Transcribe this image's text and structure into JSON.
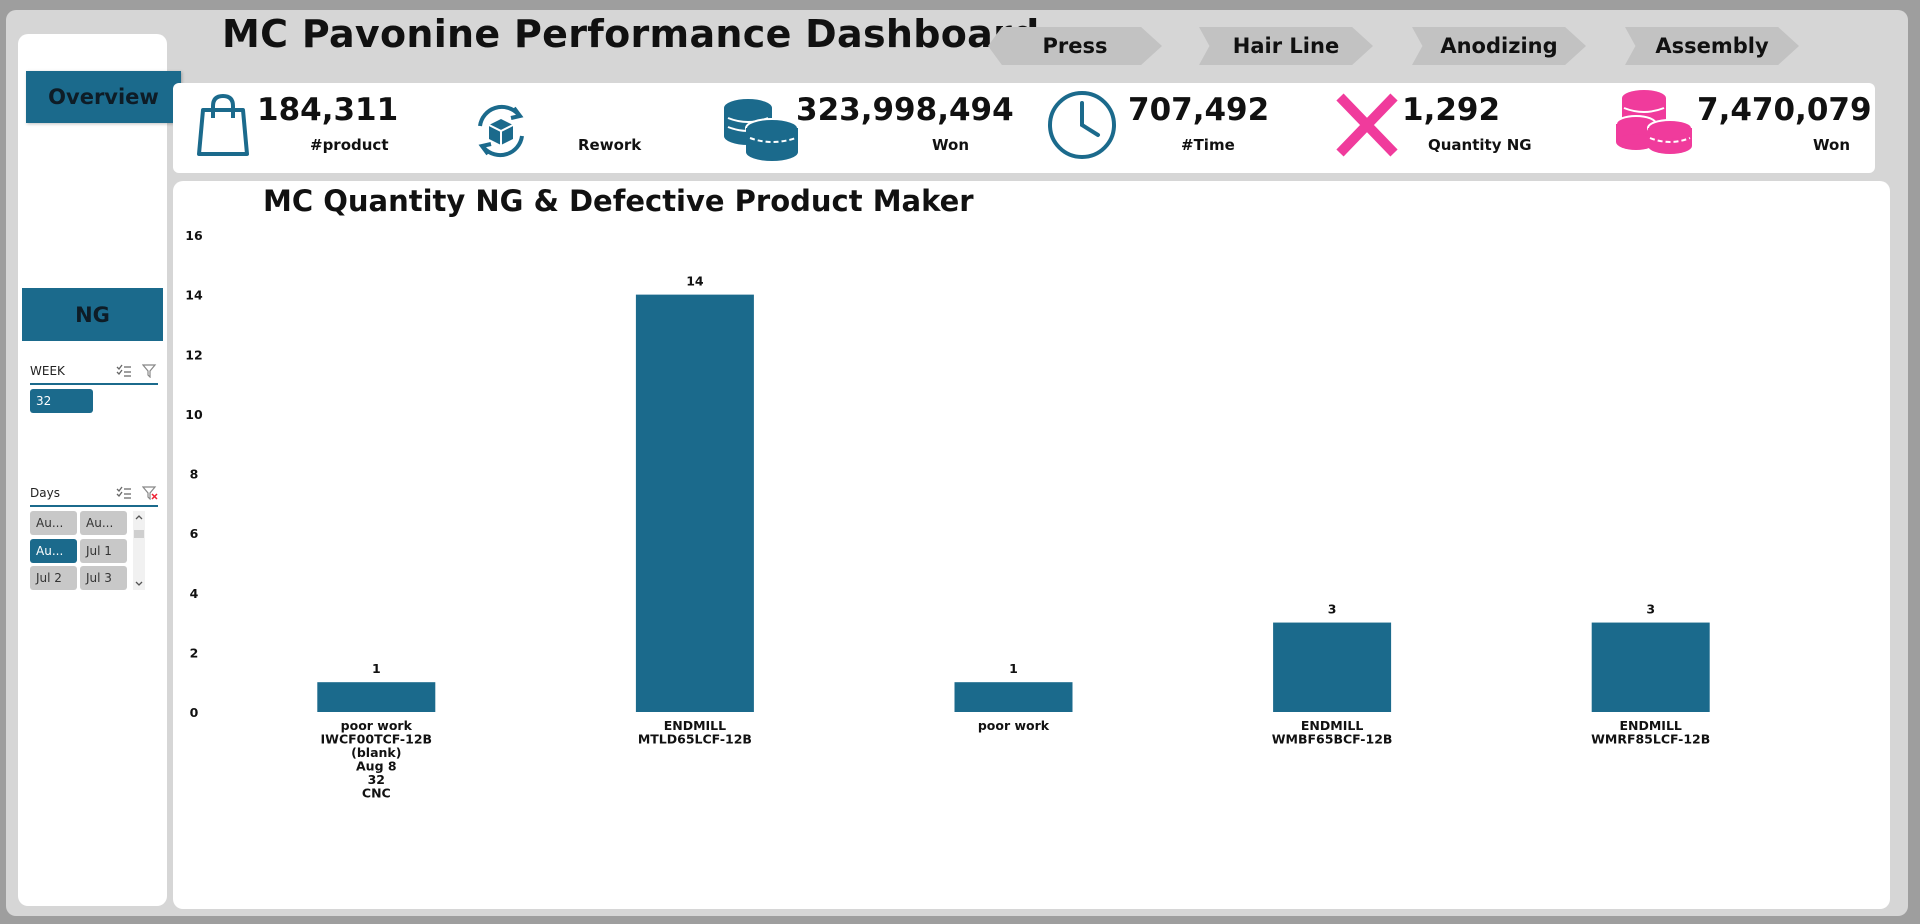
{
  "header": {
    "title": "MC Pavonine Performance Dashboard",
    "tabs": [
      {
        "label": "Press"
      },
      {
        "label": "Hair Line"
      },
      {
        "label": "Anodizing"
      },
      {
        "label": "Assembly"
      }
    ]
  },
  "sidebar": {
    "overview_label": "Overview",
    "ng_label": "NG",
    "week_slicer": {
      "title": "WEEK",
      "items": [
        {
          "label": "32",
          "selected": true
        }
      ]
    },
    "days_slicer": {
      "title": "Days",
      "items": [
        {
          "label": "Au...",
          "selected": false
        },
        {
          "label": "Au...",
          "selected": false
        },
        {
          "label": "Au...",
          "selected": true
        },
        {
          "label": "Jul 1",
          "selected": false
        },
        {
          "label": "Jul 2",
          "selected": false
        },
        {
          "label": "Jul 3",
          "selected": false
        }
      ]
    }
  },
  "kpis": [
    {
      "value": "184,311",
      "label": "#product",
      "icon": "shopping-bag-icon"
    },
    {
      "value": "",
      "label": "Rework",
      "icon": "rework-box-icon"
    },
    {
      "value": "323,998,494",
      "label": "Won",
      "icon": "coins-icon"
    },
    {
      "value": "707,492",
      "label": "#Time",
      "icon": "clock-icon"
    },
    {
      "value": "1,292",
      "label": "Quantity NG",
      "icon": "x-mark-icon"
    },
    {
      "value": "7,470,079",
      "label": "Won",
      "icon": "coins-icon"
    }
  ],
  "colors": {
    "accent": "#1b6a8c",
    "pink": "#f03b9c",
    "panel": "#ffffff",
    "background": "#d6d6d6"
  },
  "chart_data": {
    "type": "bar",
    "title": "MC Quantity NG & Defective Product Maker",
    "ylim": [
      0,
      16
    ],
    "yticks": [
      0,
      2,
      4,
      6,
      8,
      10,
      12,
      14,
      16
    ],
    "grid": false,
    "categories": [
      [
        "poor work",
        "IWCF00TCF-12B",
        "(blank)",
        "Aug  8",
        "32",
        "CNC"
      ],
      [
        "ENDMILL",
        "MTLD65LCF-12B"
      ],
      [
        "poor work"
      ],
      [
        "ENDMILL",
        "WMBF65BCF-12B"
      ],
      [
        "ENDMILL",
        "WMRF85LCF-12B"
      ]
    ],
    "values": [
      1,
      14,
      1,
      3,
      3
    ]
  }
}
